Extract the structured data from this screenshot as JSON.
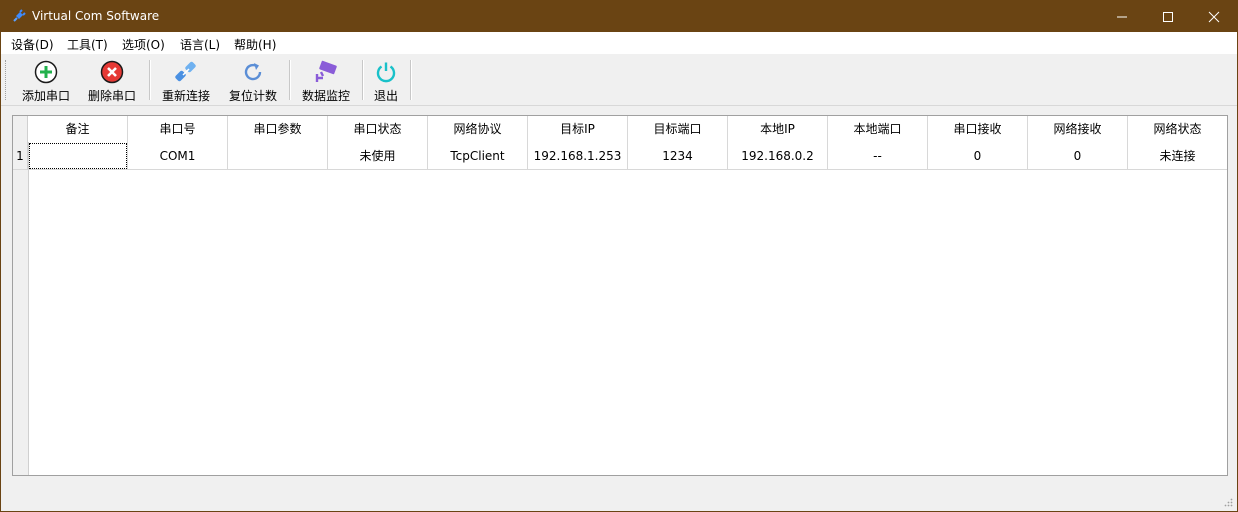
{
  "window": {
    "title": "Virtual Com Software",
    "accent_color": "#6a4413"
  },
  "menu": [
    {
      "label": "设备(D)"
    },
    {
      "label": "工具(T)"
    },
    {
      "label": "选项(O)"
    },
    {
      "label": "语言(L)"
    },
    {
      "label": "帮助(H)"
    }
  ],
  "toolbar": [
    {
      "label": "添加串口",
      "icon": "add-circle-icon"
    },
    {
      "label": "删除串口",
      "icon": "delete-circle-icon"
    },
    {
      "label": "重新连接",
      "icon": "reconnect-icon"
    },
    {
      "label": "复位计数",
      "icon": "refresh-icon"
    },
    {
      "label": "数据监控",
      "icon": "camera-monitor-icon"
    },
    {
      "label": "退出",
      "icon": "power-icon"
    }
  ],
  "table": {
    "columns": [
      "备注",
      "串口号",
      "串口参数",
      "串口状态",
      "网络协议",
      "目标IP",
      "目标端口",
      "本地IP",
      "本地端口",
      "串口接收",
      "网络接收",
      "网络状态"
    ],
    "rows": [
      {
        "index": "1",
        "cells": [
          "",
          "COM1",
          "",
          "未使用",
          "TcpClient",
          "192.168.1.253",
          "1234",
          "192.168.0.2",
          "--",
          "0",
          "0",
          "未连接"
        ]
      }
    ]
  }
}
